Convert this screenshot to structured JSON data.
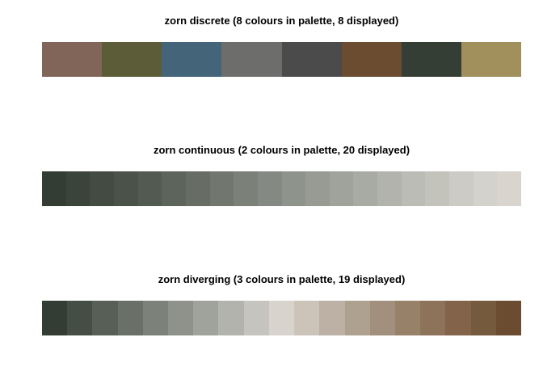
{
  "chart_data": [
    {
      "type": "heatmap",
      "title": "zorn discrete (8 colours in palette, 8 displayed)",
      "colors": [
        "#826559",
        "#5d5c38",
        "#436479",
        "#6d6e6b",
        "#4a4b4a",
        "#6b4c31",
        "#353e34",
        "#a18f5c"
      ]
    },
    {
      "type": "heatmap",
      "title": "zorn continuous (2 colours in palette, 20 displayed)",
      "colors": [
        "#343d33",
        "#3b443b",
        "#434b42",
        "#4a5249",
        "#535a51",
        "#5d645b",
        "#676d64",
        "#71766e",
        "#7b8079",
        "#858983",
        "#8e938b",
        "#979b93",
        "#a0a39c",
        "#a8aba4",
        "#b2b3ad",
        "#bbbcb5",
        "#c3c3bc",
        "#cccbc5",
        "#d4d2cc",
        "#d9d5ce"
      ]
    },
    {
      "type": "heatmap",
      "title": "zorn diverging (3 colours in palette, 19 displayed)",
      "colors": [
        "#343d33",
        "#454e45",
        "#575f56",
        "#6a6f68",
        "#7c817a",
        "#8f928b",
        "#a0a39c",
        "#b3b3ad",
        "#c6c4be",
        "#d8d4cd",
        "#ccc4b9",
        "#bdb1a5",
        "#afa190",
        "#a28f7d",
        "#978269",
        "#8d7359",
        "#83644b",
        "#765a3e",
        "#6b4c31"
      ]
    }
  ]
}
